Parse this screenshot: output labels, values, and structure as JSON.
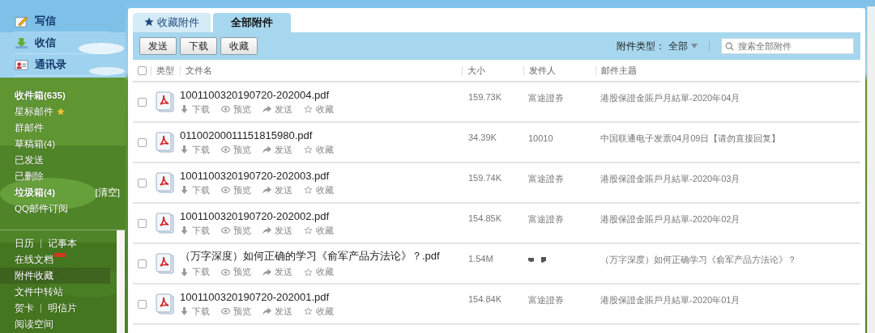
{
  "sidebar": {
    "actions": [
      {
        "label": "写信",
        "kind": "compose"
      },
      {
        "label": "收信",
        "kind": "inbox"
      },
      {
        "label": "通讯录",
        "kind": "contacts"
      }
    ],
    "folders": [
      {
        "label": "收件箱(635)",
        "bold": true,
        "starred": false
      },
      {
        "label": "星标邮件",
        "bold": false,
        "starred": true
      },
      {
        "label": "群邮件",
        "bold": false,
        "starred": false
      },
      {
        "label": "草稿箱(4)",
        "bold": false,
        "starred": false
      },
      {
        "label": "已发送",
        "bold": false,
        "starred": false
      },
      {
        "label": "已删除",
        "bold": false,
        "starred": false
      },
      {
        "label": "垃圾箱(4)",
        "bold": true,
        "starred": false,
        "action": "[清空]"
      },
      {
        "label": "QQ邮件订阅",
        "bold": false,
        "starred": false
      }
    ],
    "apps": [
      {
        "items": [
          "日历",
          "记事本"
        ],
        "selected": false,
        "new": false
      },
      {
        "items": [
          "在线文档"
        ],
        "selected": false,
        "new": true
      },
      {
        "items": [
          "附件收藏"
        ],
        "selected": true,
        "new": false
      },
      {
        "items": [
          "文件中转站"
        ],
        "selected": false,
        "new": false
      },
      {
        "items": [
          "贺卡",
          "明信片"
        ],
        "selected": false,
        "new": false
      },
      {
        "items": [
          "阅读空间"
        ],
        "selected": false,
        "new": false
      }
    ]
  },
  "tabs": [
    {
      "label": "收藏附件",
      "starred": true,
      "selected": false
    },
    {
      "label": "全部附件",
      "starred": false,
      "selected": true
    }
  ],
  "toolbar": {
    "buttons": [
      "发送",
      "下载",
      "收藏"
    ],
    "filter_label": "附件类型：",
    "filter_value": "全部",
    "search": {
      "placeholder": "搜索全部附件"
    }
  },
  "table": {
    "columns": [
      "类型",
      "文件名",
      "大小",
      "发件人",
      "邮件主题"
    ],
    "select_all": {
      "checked": false
    },
    "rows": [
      {
        "checked": false,
        "actions": [
          "下载",
          "预览",
          "发送",
          "收藏"
        ],
        "name": "1001100320190720-202004.pdf",
        "size": "159.73K",
        "sender": "富途證券",
        "subject": "港股保證金賬戶月結單-2020年04月"
      },
      {
        "checked": false,
        "actions": [
          "下载",
          "预览",
          "发送",
          "收藏"
        ],
        "name": "01100200011151815980.pdf",
        "size": "34.39K",
        "sender": "10010",
        "subject": "中国联通电子发票04月09日【请勿直接回复】"
      },
      {
        "checked": false,
        "actions": [
          "下载",
          "预览",
          "发送",
          "收藏"
        ],
        "name": "1001100320190720-202003.pdf",
        "size": "159.74K",
        "sender": "富途證券",
        "subject": "港股保證金賬戶月結單-2020年03月"
      },
      {
        "checked": false,
        "actions": [
          "下载",
          "预览",
          "发送",
          "收藏"
        ],
        "name": "1001100320190720-202002.pdf",
        "size": "154.85K",
        "sender": "富途證券",
        "subject": "港股保證金賬戶月結單-2020年02月"
      },
      {
        "checked": false,
        "actions": [
          "下载",
          "预览",
          "发送",
          "收藏"
        ],
        "name": "（万字深度）如何正确的学习《俞军产品方法论》？.pdf",
        "size": "1.54M",
        "subject": "（万字深度）如何正确学习《俞军产品方法论》？"
      },
      {
        "checked": false,
        "actions": [
          "下载",
          "预览",
          "发送",
          "收藏"
        ],
        "name": "1001100320190720-202001.pdf",
        "size": "154.84K",
        "sender": "富途證券",
        "subject": "港股保證金賬戶月結單-2020年01月"
      }
    ]
  }
}
